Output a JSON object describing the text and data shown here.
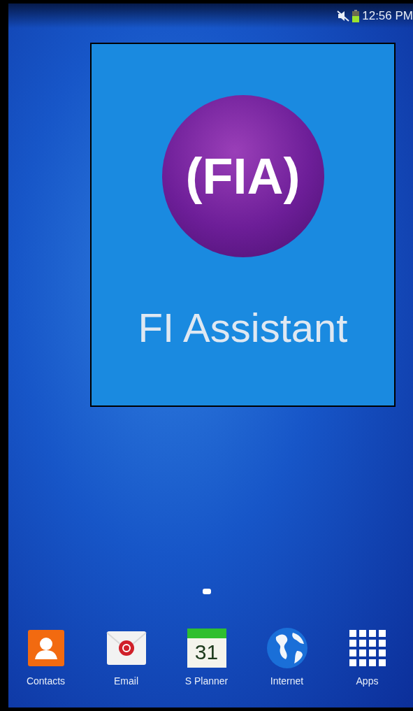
{
  "status_bar": {
    "time": "12:56 PM"
  },
  "home_screen": {
    "app_icon": {
      "icon_text": "(FIA)",
      "label": "FI Assistant"
    }
  },
  "dock": [
    {
      "kind": "contacts",
      "label": "Contacts"
    },
    {
      "kind": "email",
      "label": "Email"
    },
    {
      "kind": "calendar",
      "label": "S Planner",
      "icon_text": "31"
    },
    {
      "kind": "globe",
      "label": "Internet"
    },
    {
      "kind": "grid",
      "label": "Apps"
    }
  ]
}
